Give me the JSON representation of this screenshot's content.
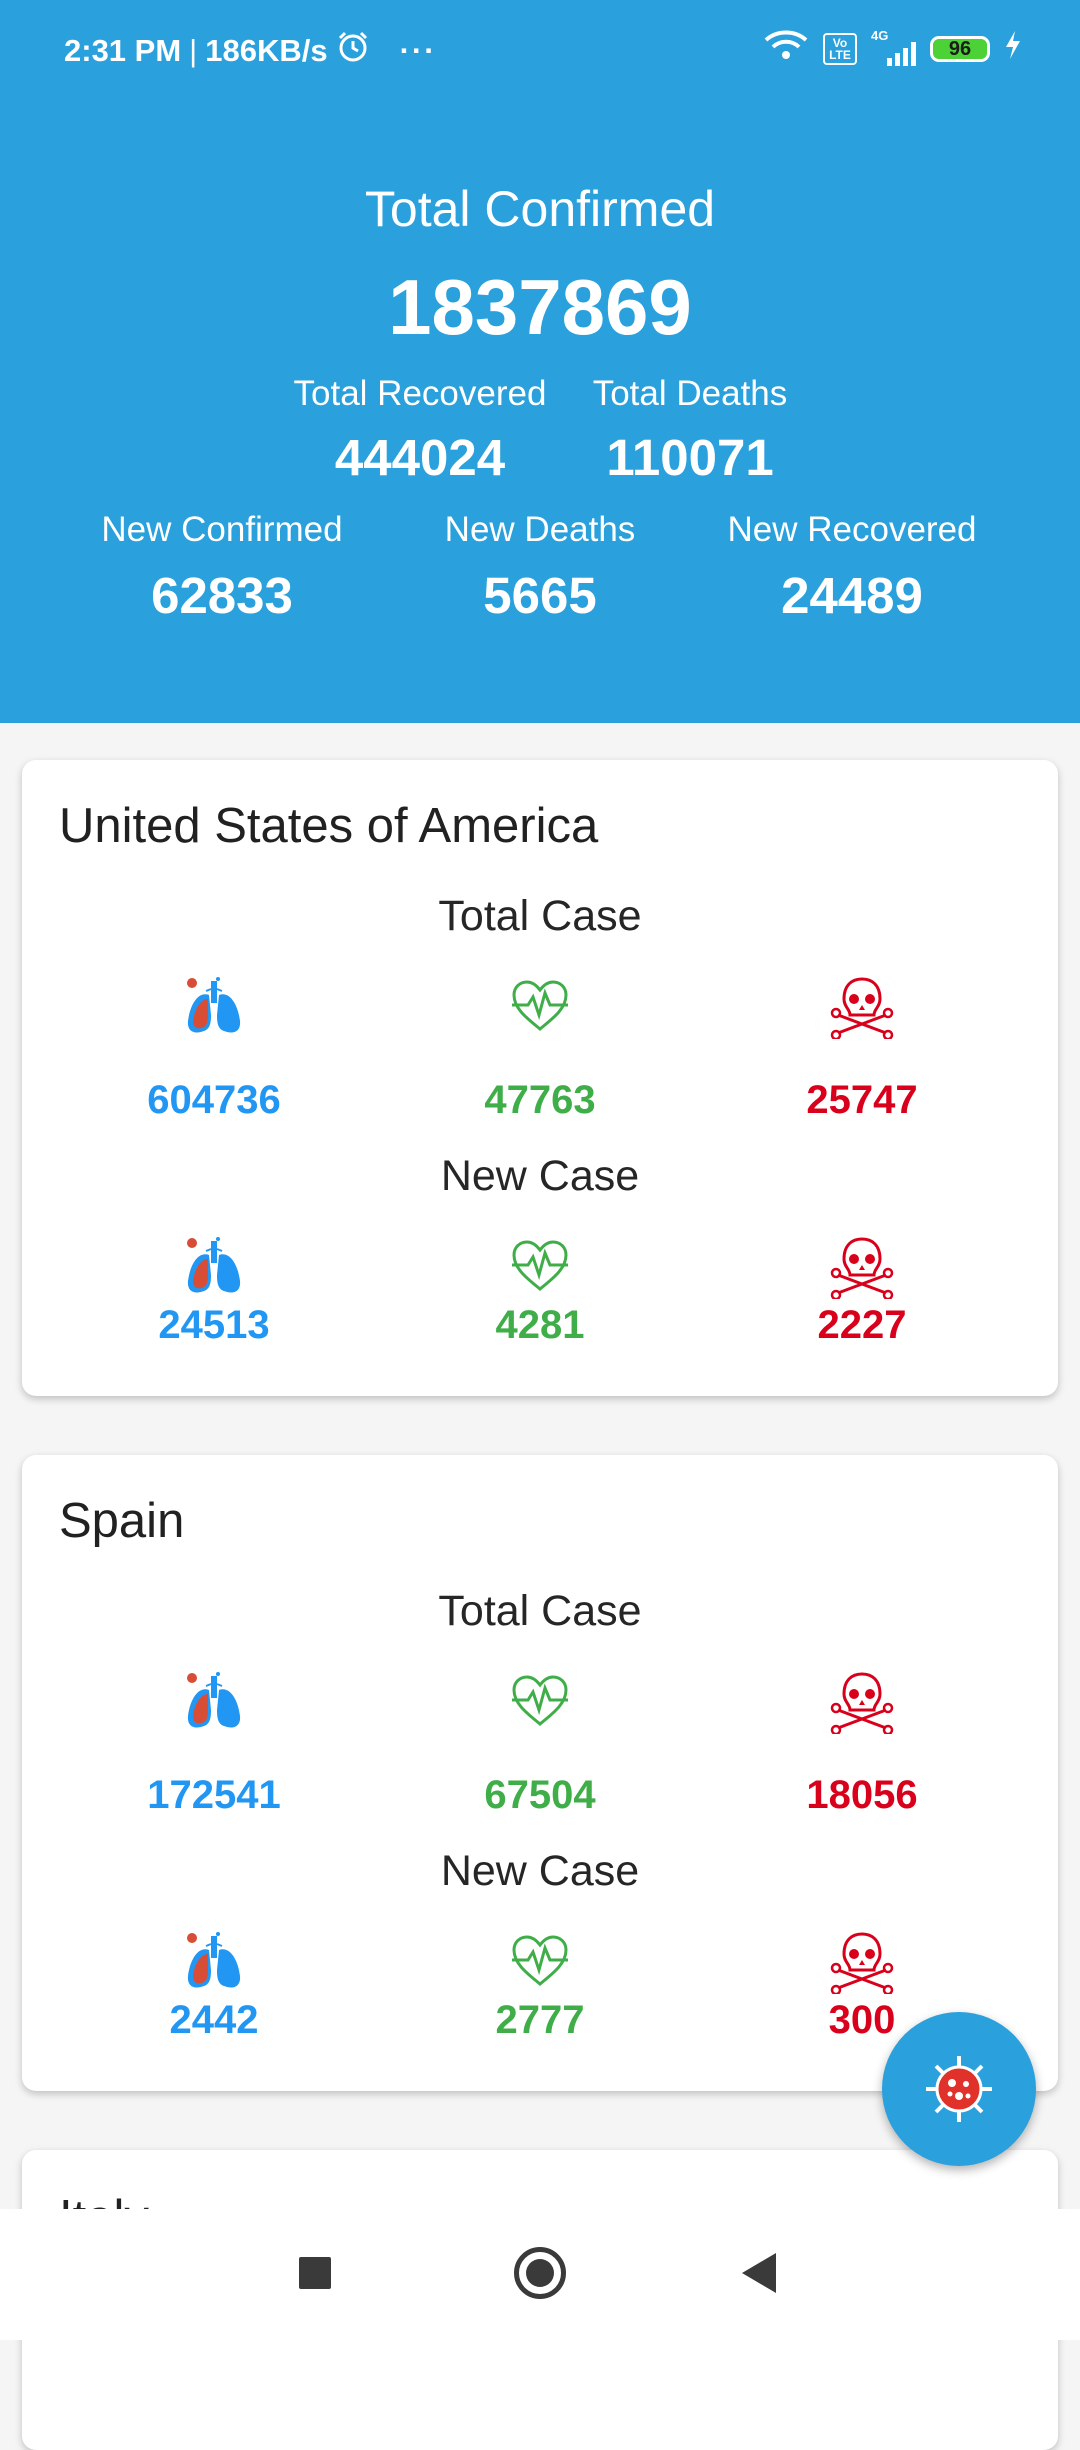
{
  "status_bar": {
    "time": "2:31 PM",
    "separator": "|",
    "speed": "186KB/s",
    "more": "···",
    "network_label": "4G",
    "volte_label": "Vo LTE",
    "battery": "96"
  },
  "summary": {
    "total_confirmed_label": "Total Confirmed",
    "total_confirmed": "1837869",
    "total_recovered_label": "Total Recovered",
    "total_recovered": "444024",
    "total_deaths_label": "Total Deaths",
    "total_deaths": "110071",
    "new_confirmed_label": "New Confirmed",
    "new_confirmed": "62833",
    "new_deaths_label": "New Deaths",
    "new_deaths": "5665",
    "new_recovered_label": "New Recovered",
    "new_recovered": "24489"
  },
  "colors": {
    "header": "#2aa0dc",
    "confirmed": "#2196f3",
    "recovered": "#3fae49",
    "deaths": "#d9001b"
  },
  "icons": {
    "confirmed": "lungs-icon",
    "recovered": "heart-pulse-icon",
    "deaths": "skull-crossbones-icon",
    "fab": "virus-icon"
  },
  "countries": [
    {
      "name": "United States of America",
      "total_label": "Total Case",
      "new_label": "New Case",
      "total": {
        "confirmed": "604736",
        "recovered": "47763",
        "deaths": "25747"
      },
      "new": {
        "confirmed": "24513",
        "recovered": "4281",
        "deaths": "2227"
      }
    },
    {
      "name": "Spain",
      "total_label": "Total Case",
      "new_label": "New Case",
      "total": {
        "confirmed": "172541",
        "recovered": "67504",
        "deaths": "18056"
      },
      "new": {
        "confirmed": "2442",
        "recovered": "2777",
        "deaths": "300"
      }
    },
    {
      "name": "Italy"
    }
  ]
}
